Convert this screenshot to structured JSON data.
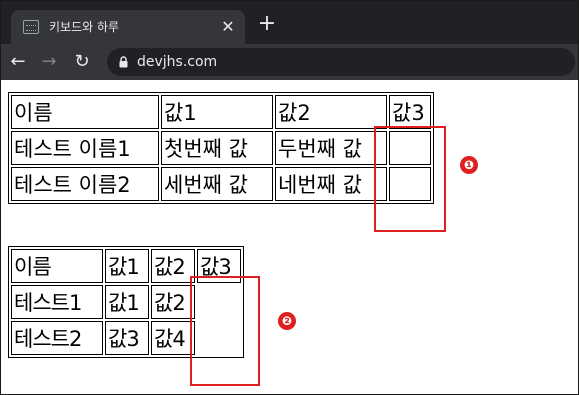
{
  "browser": {
    "tab_title": "키보드와 하루",
    "tab_close": "✕",
    "new_tab": "+",
    "url": "devjhs.com",
    "back": "←",
    "forward": "→",
    "reload": "↻"
  },
  "table1": {
    "rows": [
      [
        "이름",
        "값1",
        "값2",
        "값3"
      ],
      [
        "테스트 이름1",
        "첫번째 값",
        "두번째 값",
        ""
      ],
      [
        "테스트 이름2",
        "세번째 값",
        "네번째 값",
        ""
      ]
    ]
  },
  "table2": {
    "rows": [
      [
        "이름",
        "값1",
        "값2",
        "값3"
      ],
      [
        "테스트1",
        "값1",
        "값2"
      ],
      [
        "테스트2",
        "값3",
        "값4"
      ]
    ]
  },
  "annotations": [
    {
      "number": "❶",
      "color": "#e02020"
    },
    {
      "number": "❷",
      "color": "#e02020"
    }
  ]
}
